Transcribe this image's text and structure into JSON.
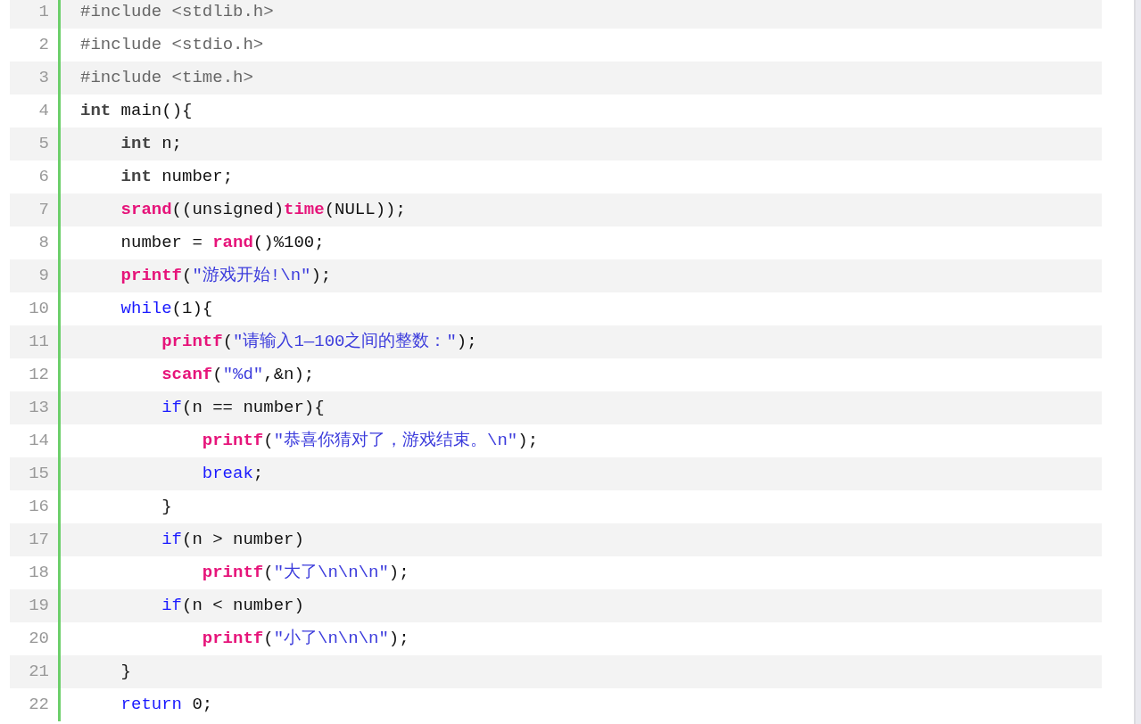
{
  "code_lines": [
    {
      "number": "1",
      "tokens": [
        {
          "kind": "pre",
          "text": "#include <stdlib.h>"
        }
      ]
    },
    {
      "number": "2",
      "tokens": [
        {
          "kind": "pre",
          "text": "#include <stdio.h>"
        }
      ]
    },
    {
      "number": "3",
      "tokens": [
        {
          "kind": "pre",
          "text": "#include <time.h>"
        }
      ]
    },
    {
      "number": "4",
      "tokens": [
        {
          "kind": "type",
          "text": "int"
        },
        {
          "kind": "plain",
          "text": " main(){"
        }
      ],
      "children": [
        {
          "number": "5",
          "tokens": [
            {
              "kind": "type",
              "text": "int"
            },
            {
              "kind": "plain",
              "text": " n;"
            }
          ]
        },
        {
          "number": "6",
          "tokens": [
            {
              "kind": "type",
              "text": "int"
            },
            {
              "kind": "plain",
              "text": " number;"
            }
          ]
        },
        {
          "number": "7",
          "tokens": [
            {
              "kind": "func",
              "text": "srand"
            },
            {
              "kind": "plain",
              "text": "((unsigned)"
            },
            {
              "kind": "func",
              "text": "time"
            },
            {
              "kind": "plain",
              "text": "(NULL));"
            }
          ]
        },
        {
          "number": "8",
          "tokens": [
            {
              "kind": "plain",
              "text": "number = "
            },
            {
              "kind": "func",
              "text": "rand"
            },
            {
              "kind": "plain",
              "text": "()%100;"
            }
          ]
        },
        {
          "number": "9",
          "tokens": [
            {
              "kind": "func",
              "text": "printf"
            },
            {
              "kind": "plain",
              "text": "("
            },
            {
              "kind": "str",
              "text": "\"游戏开始!\\n\""
            },
            {
              "kind": "plain",
              "text": ");"
            }
          ]
        },
        {
          "number": "10",
          "tokens": [
            {
              "kind": "kw",
              "text": "while"
            },
            {
              "kind": "plain",
              "text": "(1){"
            }
          ],
          "children": [
            {
              "number": "11",
              "tokens": [
                {
                  "kind": "func",
                  "text": "printf"
                },
                {
                  "kind": "plain",
                  "text": "("
                },
                {
                  "kind": "str",
                  "text": "\"请输入1—100之间的整数：\""
                },
                {
                  "kind": "plain",
                  "text": ");"
                }
              ]
            },
            {
              "number": "12",
              "tokens": [
                {
                  "kind": "func",
                  "text": "scanf"
                },
                {
                  "kind": "plain",
                  "text": "("
                },
                {
                  "kind": "str",
                  "text": "\"%d\""
                },
                {
                  "kind": "plain",
                  "text": ",&n);"
                }
              ]
            },
            {
              "number": "13",
              "tokens": [
                {
                  "kind": "kw",
                  "text": "if"
                },
                {
                  "kind": "plain",
                  "text": "(n == number){"
                }
              ],
              "children": [
                {
                  "number": "14",
                  "tokens": [
                    {
                      "kind": "func",
                      "text": "printf"
                    },
                    {
                      "kind": "plain",
                      "text": "("
                    },
                    {
                      "kind": "str",
                      "text": "\"恭喜你猜对了，游戏结束。\\n\""
                    },
                    {
                      "kind": "plain",
                      "text": ");"
                    }
                  ]
                },
                {
                  "number": "15",
                  "tokens": [
                    {
                      "kind": "kw",
                      "text": "break"
                    },
                    {
                      "kind": "plain",
                      "text": ";"
                    }
                  ]
                }
              ]
            },
            {
              "number": "16",
              "tokens": [
                {
                  "kind": "plain",
                  "text": "}"
                }
              ]
            },
            {
              "number": "17",
              "tokens": [
                {
                  "kind": "kw",
                  "text": "if"
                },
                {
                  "kind": "plain",
                  "text": "(n > number)"
                }
              ],
              "children": [
                {
                  "number": "18",
                  "tokens": [
                    {
                      "kind": "func",
                      "text": "printf"
                    },
                    {
                      "kind": "plain",
                      "text": "("
                    },
                    {
                      "kind": "str",
                      "text": "\"大了\\n\\n\\n\""
                    },
                    {
                      "kind": "plain",
                      "text": ");"
                    }
                  ]
                }
              ]
            },
            {
              "number": "19",
              "tokens": [
                {
                  "kind": "kw",
                  "text": "if"
                },
                {
                  "kind": "plain",
                  "text": "(n < number)"
                }
              ],
              "children": [
                {
                  "number": "20",
                  "tokens": [
                    {
                      "kind": "func",
                      "text": "printf"
                    },
                    {
                      "kind": "plain",
                      "text": "("
                    },
                    {
                      "kind": "str",
                      "text": "\"小了\\n\\n\\n\""
                    },
                    {
                      "kind": "plain",
                      "text": ");"
                    }
                  ]
                }
              ]
            }
          ]
        },
        {
          "number": "21",
          "tokens": [
            {
              "kind": "plain",
              "text": "}"
            }
          ]
        },
        {
          "number": "22",
          "tokens": [
            {
              "kind": "kw",
              "text": "return"
            },
            {
              "kind": "plain",
              "text": " 0;"
            }
          ]
        }
      ]
    }
  ]
}
